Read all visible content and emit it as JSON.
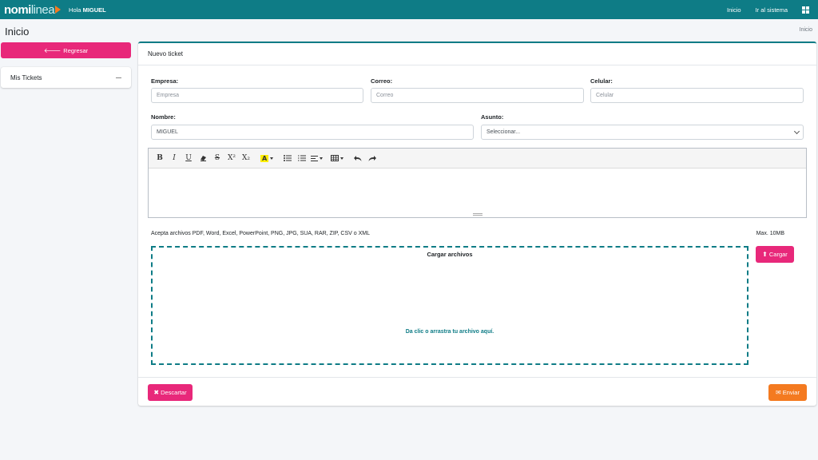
{
  "navbar": {
    "logo_main": "nomi",
    "logo_sub": "linea",
    "greeting_prefix": "Hola",
    "user_name": "MIGUEL",
    "links": [
      "Inicio",
      "Ir al sistema"
    ],
    "apps_icon": "grid-icon",
    "color": "#0e7c86"
  },
  "page": {
    "title": "Inicio",
    "breadcrumb": "Inicio"
  },
  "sidebar": {
    "back_label": "Regresar",
    "back_icon": "arrow-left-icon",
    "tickets_label": "Mis Tickets"
  },
  "form": {
    "header": "Nuevo ticket",
    "empresa": {
      "label": "Empresa:",
      "placeholder": "Empresa",
      "value": ""
    },
    "correo": {
      "label": "Correo:",
      "placeholder": "Correo",
      "value": ""
    },
    "celular": {
      "label": "Celular:",
      "placeholder": "Celular",
      "value": ""
    },
    "nombre": {
      "label": "Nombre:",
      "value": "MIGUEL"
    },
    "asunto": {
      "label": "Asunto:",
      "selected": "Seleccionar..."
    },
    "toolbar": {
      "bold": "B",
      "italic": "I",
      "underline": "U",
      "strike": "S",
      "superscript": "X²",
      "subscript": "X₂",
      "highlight": "A"
    },
    "accept_text": "Acepta archivos PDF, Word, Excel, PowerPoint, PNG, JPG, SUA, RAR, ZIP, CSV o XML",
    "max_text": "Max. 10MB",
    "dropzone_title": "Cargar archivos",
    "dropzone_hint": "Da clic o arrastra tu archivo aquí.",
    "upload_label": "Cargar",
    "discard_label": "Descartar",
    "send_label": "Enviar"
  },
  "colors": {
    "primary": "#0e7c86",
    "pink": "#e8287a",
    "orange": "#f47a20"
  }
}
